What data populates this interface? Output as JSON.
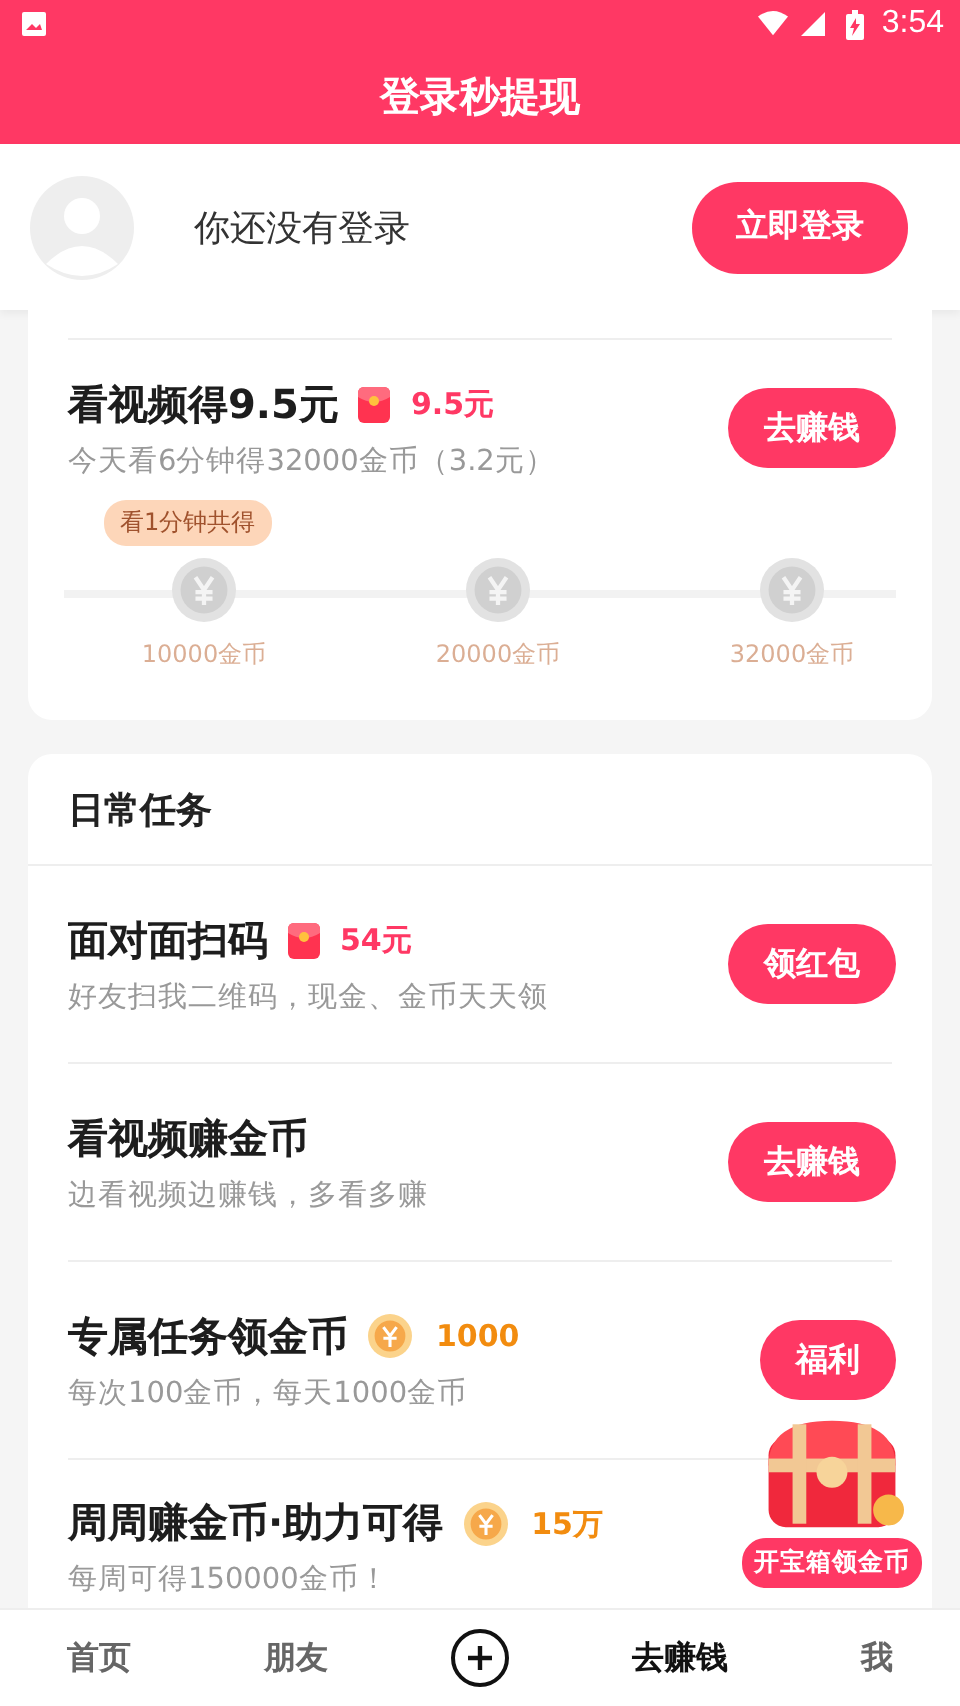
{
  "status_bar": {
    "time": "3:54"
  },
  "header": {
    "title": "登录秒提现"
  },
  "login": {
    "prompt": "你还没有登录",
    "button": "立即登录"
  },
  "video_task": {
    "title": "看视频得9.5元",
    "reward": {
      "kind": "redpacket",
      "amount": "9.5元"
    },
    "subtitle": "今天看6分钟得32000金币（3.2元）",
    "button": "去赚钱",
    "bubble": "看1分钟共得",
    "milestones": [
      {
        "label": "10000金币"
      },
      {
        "label": "20000金币"
      },
      {
        "label": "32000金币"
      }
    ]
  },
  "daily": {
    "title": "日常任务",
    "tasks": [
      {
        "title": "面对面扫码",
        "reward": {
          "kind": "redpacket",
          "amount": "54元"
        },
        "subtitle": "好友扫我二维码，现金、金币天天领",
        "button": "领红包"
      },
      {
        "title": "看视频赚金币",
        "subtitle": "边看视频边赚钱，多看多赚",
        "button": "去赚钱"
      },
      {
        "title": "专属任务领金币",
        "reward": {
          "kind": "coin",
          "amount": "1000"
        },
        "subtitle": "每次100金币，每天1000金币",
        "button": "福利"
      },
      {
        "title": "周周赚金币·助力可得",
        "reward": {
          "kind": "coin",
          "amount": "15万"
        },
        "subtitle": "每周可得150000金币！"
      }
    ]
  },
  "treasure": {
    "label": "开宝箱领金币"
  },
  "nav": [
    {
      "kind": "text",
      "label": "首页",
      "selected": false
    },
    {
      "kind": "text",
      "label": "朋友",
      "selected": false
    },
    {
      "kind": "plus",
      "selected": false
    },
    {
      "kind": "text",
      "label": "去赚钱",
      "selected": true
    },
    {
      "kind": "text",
      "label": "我",
      "selected": false
    }
  ]
}
